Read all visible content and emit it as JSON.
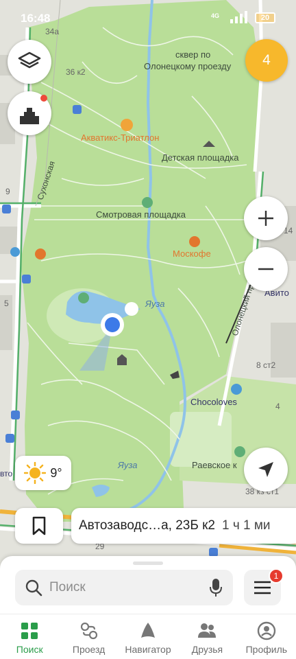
{
  "status": {
    "time": "16:48",
    "network": "4G",
    "battery": "20"
  },
  "map": {
    "labels": {
      "skver": "сквер по",
      "skver2": "Олонецкому проезду",
      "akvatiks": "Акватикс-Триатлон",
      "detskaya": "Детская площадка",
      "smotrovaya": "Смотровая площадка",
      "moskofe": "Москофе",
      "yauza1": "Яуза",
      "yauza2": "Яуза",
      "olonetsky": "Олонецкий проезд",
      "sukhonskaya": "Сухонская",
      "chocoloves": "Chocoloves",
      "raevskoe": "Раевское к",
      "avito": "Авито",
      "n34a": "34а",
      "n36k2": "36 к2",
      "n9": "9",
      "n5": "5",
      "n8st2": "8 ст2",
      "n4": "4",
      "n14": "14",
      "n38kz": "38 кз ст1",
      "n29": "29",
      "nvto": "вто"
    },
    "colors": {
      "park": "#b9de98",
      "park_light": "#cfe9b6",
      "water": "#8fc3e8",
      "road": "#ffffff",
      "highway": "#54b06a",
      "accent": "#2a9d4a",
      "poi_orange": "#e2762e"
    }
  },
  "controls": {
    "layers_icon": "layers-icon",
    "city_icon": "building-icon",
    "counter": "4",
    "zoom_in": "+",
    "zoom_out": "−",
    "locate_icon": "navigation-arrow-icon"
  },
  "weather": {
    "temp": "9°",
    "icon": "sun-icon"
  },
  "route": {
    "address": "Автозаводс…а, 23Б к2",
    "eta": "1 ч 1 ми"
  },
  "search": {
    "placeholder": "Поиск",
    "menu_badge": "1"
  },
  "tabs": [
    {
      "label": "Поиск",
      "icon": "grid-icon",
      "active": true
    },
    {
      "label": "Проезд",
      "icon": "transit-icon",
      "active": false
    },
    {
      "label": "Навигатор",
      "icon": "navigator-icon",
      "active": false
    },
    {
      "label": "Друзья",
      "icon": "friends-icon",
      "active": false
    },
    {
      "label": "Профиль",
      "icon": "profile-icon",
      "active": false
    }
  ]
}
